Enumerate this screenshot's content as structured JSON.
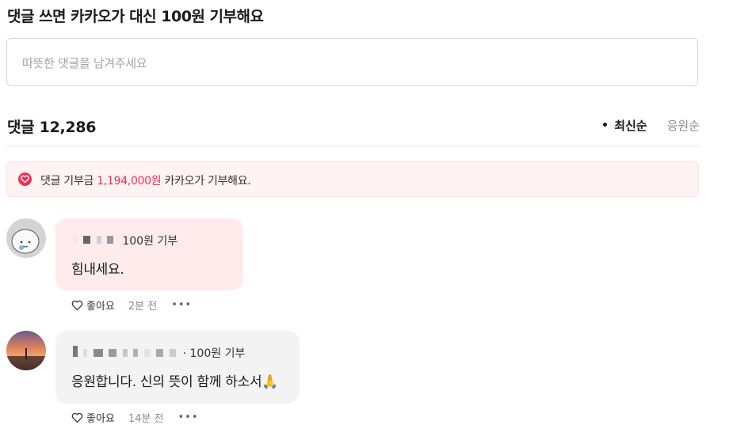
{
  "header": {
    "title": "댓글 쓰면 카카오가 대신 100원 기부해요"
  },
  "comment_input": {
    "placeholder": "따뜻한 댓글을 남겨주세요"
  },
  "summary": {
    "count_label": "댓글 12,286",
    "sort_options": [
      {
        "label": "최신순",
        "active": true
      },
      {
        "label": "응원순",
        "active": false
      }
    ]
  },
  "donation": {
    "prefix": "댓글 기부금",
    "amount": "1,194,000원",
    "suffix": "카카오가 기부해요.",
    "icon": "heart-icon",
    "accent": "#ef2f54"
  },
  "comments": [
    {
      "donation_label": "100원 기부",
      "text": "힘내세요.",
      "like_label": "좋아요",
      "time": "2분 전",
      "bubble_color": "#ffebeb"
    },
    {
      "donation_label": "· 100원 기부",
      "text": "응원합니다. 신의 뜻이 함께 하소서🙏",
      "like_label": "좋아요",
      "time": "14분 전",
      "bubble_color": "#f3f3f3"
    }
  ]
}
